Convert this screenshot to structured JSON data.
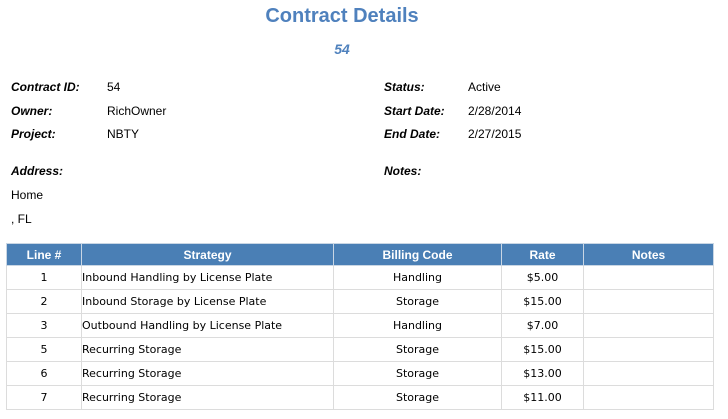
{
  "header": {
    "title": "Contract Details",
    "subtitle": "54"
  },
  "fields": {
    "contract_id": {
      "label": "Contract ID:",
      "value": "54"
    },
    "owner": {
      "label": "Owner:",
      "value": "RichOwner"
    },
    "project": {
      "label": "Project:",
      "value": "NBTY"
    },
    "status": {
      "label": "Status:",
      "value": "Active"
    },
    "start_date": {
      "label": "Start Date:",
      "value": "2/28/2014"
    },
    "end_date": {
      "label": "End Date:",
      "value": "2/27/2015"
    },
    "address": {
      "label": "Address:",
      "line1": "Home",
      "line2": ", FL"
    },
    "notes": {
      "label": "Notes:"
    }
  },
  "table": {
    "headers": [
      "Line #",
      "Strategy",
      "Billing Code",
      "Rate",
      "Notes"
    ],
    "rows": [
      {
        "line": "1",
        "strategy": "Inbound Handling by License Plate",
        "code": "Handling",
        "rate": "$5.00",
        "notes": ""
      },
      {
        "line": "2",
        "strategy": "Inbound Storage by License Plate",
        "code": "Storage",
        "rate": "$15.00",
        "notes": ""
      },
      {
        "line": "3",
        "strategy": "Outbound Handling by License Plate",
        "code": "Handling",
        "rate": "$7.00",
        "notes": ""
      },
      {
        "line": "5",
        "strategy": "Recurring Storage",
        "code": "Storage",
        "rate": "$15.00",
        "notes": ""
      },
      {
        "line": "6",
        "strategy": "Recurring Storage",
        "code": "Storage",
        "rate": "$13.00",
        "notes": ""
      },
      {
        "line": "7",
        "strategy": "Recurring Storage",
        "code": "Storage",
        "rate": "$11.00",
        "notes": ""
      }
    ]
  },
  "colors": {
    "title": "#4f81bd",
    "header_bg": "#4a7fb5",
    "header_text": "#ffffff"
  }
}
